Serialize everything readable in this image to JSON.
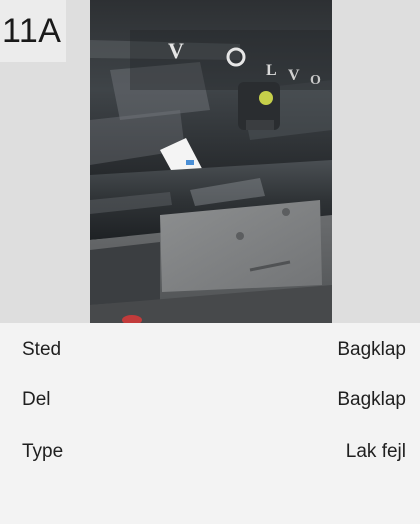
{
  "damage": {
    "code": "11A",
    "photo_alt": "Bagklap"
  },
  "details": {
    "rows": [
      {
        "label": "Sted",
        "value": "Bagklap"
      },
      {
        "label": "Del",
        "value": "Bagklap"
      },
      {
        "label": "Type",
        "value": "Lak fejl"
      }
    ]
  },
  "photo_logo_text": "VOLVO"
}
